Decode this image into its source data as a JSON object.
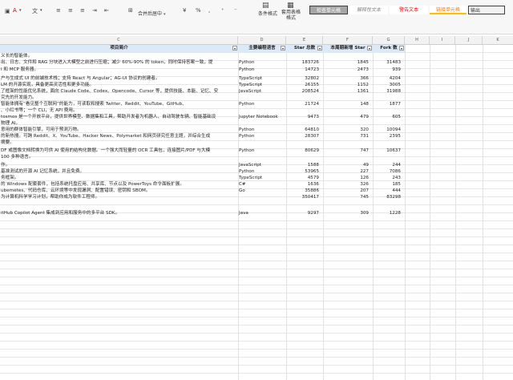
{
  "ribbon": {
    "merge_center": "合并后居中",
    "conditional_format": "条件格式",
    "table_format": "套用表格\n格式",
    "styles": [
      {
        "label": "检查单元格",
        "bg": "#a5a5a5",
        "fg": "#ffffff"
      },
      {
        "label": "解释性文本",
        "bg": "#ffffff",
        "fg": "#7f7f7f"
      },
      {
        "label": "警告文本",
        "bg": "#ffffff",
        "fg": "#ff0000"
      },
      {
        "label": "链接单元格",
        "bg": "#ffffff",
        "fg": "#fa7d00"
      },
      {
        "label": "输出",
        "bg": "#f2f2f2",
        "fg": "#3f3f3f"
      }
    ]
  },
  "columns": [
    "C",
    "D",
    "E",
    "F",
    "G",
    "H",
    "I",
    "J",
    "K"
  ],
  "headers": {
    "c": "项目简介",
    "d": "主要编程语言",
    "e": "Star 总数",
    "f": "本周期新增 Star",
    "g": "Fork 数"
  },
  "rows": [
    {
      "c": "义长的智能体。",
      "d": "",
      "e": "",
      "f": "",
      "g": ""
    },
    {
      "c": "出、日志、文件和 RAG 分块进入大模型之前进行压缩；减少 60%-90% 的 token，同时保持答案一致，提",
      "d": "Python",
      "e": "183726",
      "f": "1845",
      "g": "31483"
    },
    {
      "c": "I 和 MCP 服务器。",
      "d": "Python",
      "e": "14723",
      "f": "2473",
      "g": "939"
    },
    {
      "c": "户与生成式 UI 的前端技术栈；支持 React 与 Angular；AG-UI 协议的创建者。",
      "d": "TypeScript",
      "e": "32802",
      "f": "366",
      "g": "4204"
    },
    {
      "c": " LM 的开源实现，具备更高灵活性和更多功能。",
      "d": "TypeScript",
      "e": "26155",
      "f": "1152",
      "g": "3005"
    },
    {
      "c": "了框架的性能优化系统，面向 Claude Code、Codex、Opencode、Cursor 等，提供技能、本能、记忆、安",
      "d": "JavaScript",
      "e": "208524",
      "f": "1361",
      "g": "31988"
    },
    {
      "c": "究先的开发能力。",
      "d": "",
      "e": "",
      "f": "",
      "g": ""
    },
    {
      "c": " 智能体拥有“看见整个互联网”的能力，可读取和搜索 Twitter、Reddit、YouTube、GitHub、",
      "d": "Python",
      "e": "21724",
      "f": "148",
      "g": "1877"
    },
    {
      "c": "、小红书等；一个 CLI，无 API 费用。",
      "d": "",
      "e": "",
      "f": "",
      "g": ""
    },
    {
      "c": "tosmos 是一个开放平台，提供世界模型、数据集和工具，帮助开发者为机器人、自动驾驶车辆、智能基础设",
      "d": "Jupyter Notebook",
      "e": "9473",
      "f": "479",
      "g": "605"
    },
    {
      "c": "物理 AI。",
      "d": "",
      "e": "",
      "f": "",
      "g": ""
    },
    {
      "c": "意用的群体智能引擎，可用于预测万物。",
      "d": "Python",
      "e": "64810",
      "f": "320",
      "g": "10094"
    },
    {
      "c": "的新热搜。可跨 Reddit、X、YouTube、Hacker News、Polymarket 和网页研究任意主题，并综合生成",
      "d": "Python",
      "e": "28307",
      "f": "731",
      "g": "2395"
    },
    {
      "c": "摘要。",
      "d": "",
      "e": "",
      "f": "",
      "g": ""
    },
    {
      "c": "DF 或图像文档转换为可供 AI 使用的结构化数据。一个强大而轻量的 OCR 工具包，连接图片/PDF 与大模",
      "d": "Python",
      "e": "80629",
      "f": "747",
      "g": "10637"
    },
    {
      "c": " 100 多种语言。",
      "d": "",
      "e": "",
      "f": "",
      "g": ""
    },
    {
      "c": "作。",
      "d": "JavaScript",
      "e": "1588",
      "f": "49",
      "g": "244"
    },
    {
      "c": "基准测试的开源 AI 记忆系统，并且免费。",
      "d": "Python",
      "e": "53965",
      "f": "227",
      "g": "7086"
    },
    {
      "c": "务框架。",
      "d": "TypeScript",
      "e": "4579",
      "f": "126",
      "g": "243"
    },
    {
      "c": " 的 Windows 配套套件，包括系统托盘应用、共享库、节点以及 PowerToys 命令面板扩展。",
      "d": "C#",
      "e": "1636",
      "f": "326",
      "g": "185"
    },
    {
      "c": "ubernetes、代码仓库、云环境等中发现漏洞、配置错误、密钥和 SBOM。",
      "d": "Go",
      "e": "35886",
      "f": "207",
      "g": "444"
    },
    {
      "c": "为计算机科学学习计划，帮助你成为软件工程师。",
      "d": "",
      "e": "350417",
      "f": "745",
      "g": "83298"
    },
    {
      "c": "",
      "d": "",
      "e": "",
      "f": "",
      "g": ""
    },
    {
      "c": "itHub Copilot Agent 集成到应用和服务中的多平台 SDK。",
      "d": "Java",
      "e": "9297",
      "f": "309",
      "g": "1228"
    }
  ]
}
